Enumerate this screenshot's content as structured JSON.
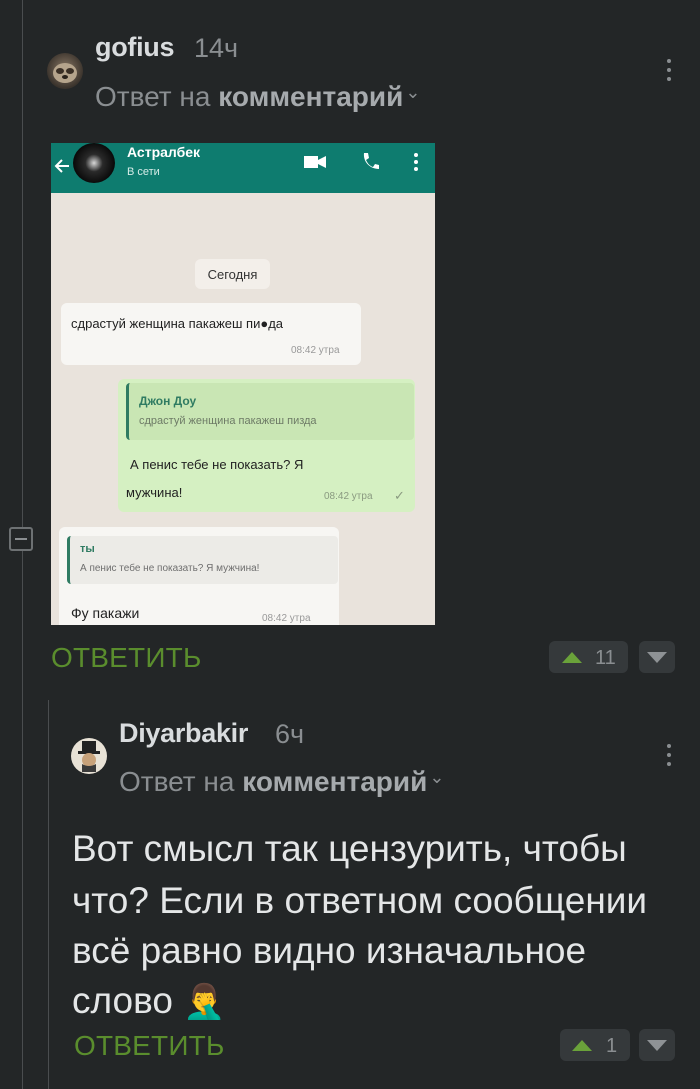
{
  "comment1": {
    "username": "gofius",
    "time": "14ч",
    "reply_prefix": "Ответ на",
    "reply_target": "комментарий",
    "reply_chevron": "⌄",
    "reply_button": "ОТВЕТИТЬ",
    "votes": "11"
  },
  "screenshot": {
    "contact_name": "Астралбек",
    "contact_status": "В сети",
    "date_chip": "Сегодня",
    "msg1": {
      "text": "сдрастуй женщина пакажеш пи●да",
      "time": "08:42 утра"
    },
    "msg2": {
      "quote_author": "Джон Доу",
      "quote_text": "сдрастуй женщина пакажеш пизда",
      "text_line1": "А пенис тебе не показать? Я",
      "text_line2": "мужчина!",
      "time": "08:42 утра",
      "check": "✓"
    },
    "msg3": {
      "quote_author": "ты",
      "quote_text": "А пенис тебе не показать? Я мужчина!",
      "text": "Фу пакажи",
      "time": "08:42 утра"
    }
  },
  "comment2": {
    "username": "Diyarbakir",
    "time": "6ч",
    "reply_prefix": "Ответ на",
    "reply_target": "комментарий",
    "reply_chevron": "⌄",
    "text_line1": "Вот смысл так цензурить, чтобы",
    "text_line2": "что? Если в ответном сообщении",
    "text_line3": "всё равно видно изначальное",
    "text_line4": "слово",
    "emoji": "🤦‍♂️",
    "reply_button": "ОТВЕТИТЬ",
    "votes": "1"
  },
  "colors": {
    "background": "#232627",
    "reply_green": "#5a8d2d",
    "upvote_green": "#6aa23a",
    "whatsapp_teal": "#0e7c6f"
  }
}
